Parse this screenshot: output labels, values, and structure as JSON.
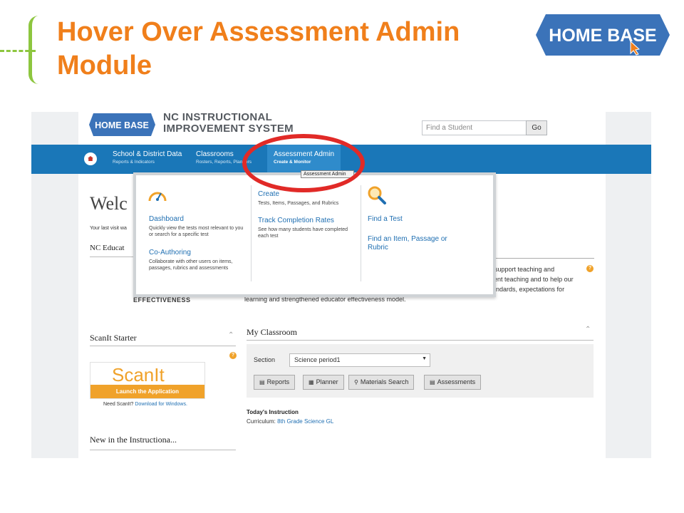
{
  "slide": {
    "title": "Hover Over Assessment Admin Module",
    "logo_text": "HOME BASE"
  },
  "portal": {
    "logo_text": "HOME BASE",
    "system_name_line1": "NC INSTRUCTIONAL",
    "system_name_line2": "IMPROVEMENT SYSTEM",
    "search": {
      "placeholder": "Find a Student",
      "go_label": "Go"
    }
  },
  "nav": {
    "items": [
      {
        "title": "School & District Data",
        "subtitle": "Reports & Indicators"
      },
      {
        "title": "Classrooms",
        "subtitle": "Rosters, Reports, Planners"
      },
      {
        "title": "Assessment Admin",
        "subtitle": "Create & Monitor"
      }
    ],
    "tooltip": "Assessment Admin"
  },
  "dropdown": {
    "col1": [
      {
        "label": "Dashboard",
        "desc": "Quickly view the tests most relevant to you or search for a specific test"
      },
      {
        "label": "Co-Authoring",
        "desc": "Collaborate with other users on items, passages, rubrics and assessments"
      }
    ],
    "col2": [
      {
        "label": "Create",
        "desc": "Tests, Items, Passages, and Rubrics"
      },
      {
        "label": "Track Completion Rates",
        "desc": "See how many students have completed each test"
      }
    ],
    "col3": [
      {
        "label": "Find a Test"
      },
      {
        "label": "Find an Item, Passage or Rubric"
      }
    ]
  },
  "page": {
    "welcome": "Welc",
    "last_visit": "Your last visit wa",
    "nc_educator": "NC Educat",
    "effectiveness": "EFFECTIVENESS",
    "intro_lines": [
      "to support teaching and",
      "ellent teaching and to help our",
      "standards, expectations for",
      "learning and strengthened educator effectiveness model."
    ],
    "scanit_heading": "ScanIt Starter",
    "scanit_logo": "ScanIt",
    "scanit_launch": "Launch the Application",
    "need_scanit": "Need ScanIt?",
    "download_link": "Download for Windows.",
    "new_in_instructional": "New in the Instructiona...",
    "help_icon_glyph": "?",
    "my_classroom": {
      "heading": "My Classroom",
      "section_label": "Section",
      "section_value": "Science period1",
      "buttons": [
        "Reports",
        "Planner",
        "Materials Search",
        "Assessments"
      ]
    },
    "todays_instruction": "Today's Instruction",
    "curriculum_label": "Curriculum:",
    "curriculum_value": "8th Grade Science GL"
  },
  "colors": {
    "title_orange": "#f07f1b",
    "accent_green": "#8dc63f",
    "nav_blue": "#1a77b8",
    "logo_blue": "#3b73b9",
    "link_blue": "#1f6fb2",
    "highlight_red": "#e12a27",
    "scanit_gold": "#f0a22a"
  }
}
